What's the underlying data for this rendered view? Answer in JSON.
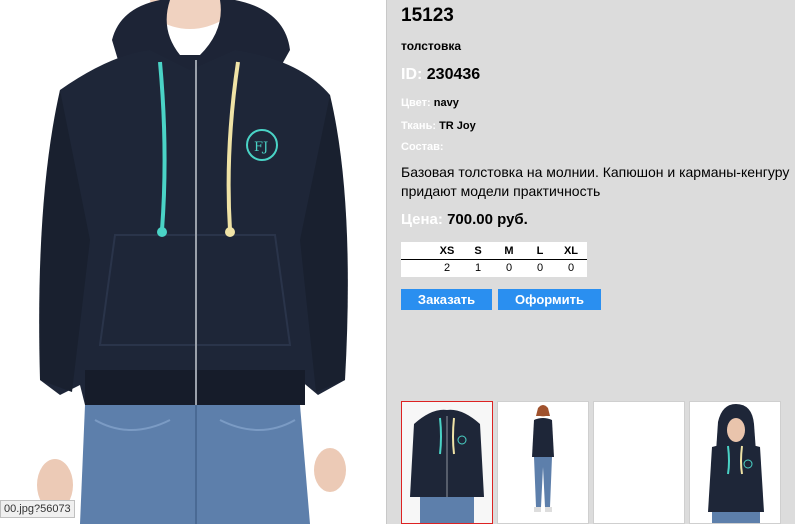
{
  "product": {
    "title": "15123",
    "subtitle": "толстовка",
    "id_label": "ID:",
    "id_value": "230436",
    "color_label": "Цвет:",
    "color_value": "navy",
    "fabric_label": "Ткань:",
    "fabric_value": "TR Joy",
    "composition_label": "Состав:",
    "description": "Базовая толстовка на молнии. Капюшон и карманы-кенгуру придают модели практичность",
    "price_label": "Цена:",
    "price_value": "700.00 руб."
  },
  "sizes": {
    "headers": [
      "XS",
      "S",
      "M",
      "L",
      "XL"
    ],
    "values": [
      "2",
      "1",
      "0",
      "0",
      "0"
    ]
  },
  "buttons": {
    "order": "Заказать",
    "checkout": "Оформить"
  },
  "status_url": "00.jpg?56073",
  "colors": {
    "panel_bg": "#dcdcdc",
    "button_blue": "#2a8ff0",
    "hoodie_navy": "#1e2638",
    "selected_border": "#dd2222"
  }
}
